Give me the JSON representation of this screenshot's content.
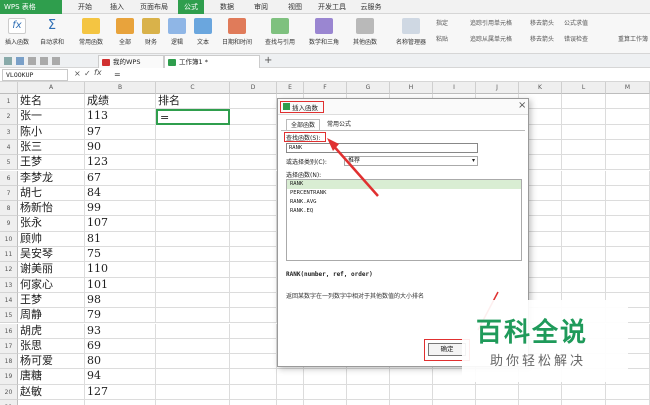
{
  "menu": {
    "app_label": "WPS 表格",
    "tabs": [
      "开始",
      "插入",
      "页面布局",
      "公式",
      "数据",
      "审阅",
      "视图",
      "开发工具",
      "云服务"
    ],
    "active_tab": "公式"
  },
  "ribbon": {
    "buttons": [
      "插入函数",
      "自动求和",
      "常用函数",
      "全部",
      "财务",
      "逻辑",
      "文本",
      "日期和时间",
      "查找与引用",
      "数学和三角",
      "其他函数",
      "名称管理器",
      "粘贴"
    ],
    "small_items": [
      "指定",
      "追踪引用单元格",
      "移去箭头",
      "追踪从属单元格",
      "移去箭头",
      "公式求值",
      "错误检查",
      "重算工作簿"
    ]
  },
  "doc_tabs": [
    "我的WPS",
    "工作簿1 *"
  ],
  "formula_bar": {
    "name_box": "VLOOKUP",
    "fx": "fx",
    "value": "="
  },
  "columns": [
    "A",
    "B",
    "C",
    "D",
    "E",
    "F",
    "G",
    "H",
    "I",
    "J",
    "K",
    "L",
    "M"
  ],
  "rows": [
    "1",
    "2",
    "3",
    "4",
    "5",
    "6",
    "7",
    "8",
    "9",
    "10",
    "11",
    "12",
    "13",
    "14",
    "15",
    "16",
    "17",
    "18",
    "19",
    "20",
    "21"
  ],
  "table": [
    [
      "姓名",
      "成绩",
      "排名"
    ],
    [
      "张一",
      "113",
      "="
    ],
    [
      "陈小",
      "97",
      ""
    ],
    [
      "张三",
      "90",
      ""
    ],
    [
      "王梦",
      "123",
      ""
    ],
    [
      "李梦龙",
      "67",
      ""
    ],
    [
      "胡七",
      "84",
      ""
    ],
    [
      "杨新怡",
      "99",
      ""
    ],
    [
      "张永",
      "107",
      ""
    ],
    [
      "顾帅",
      "81",
      ""
    ],
    [
      "吴安琴",
      "75",
      ""
    ],
    [
      "谢美丽",
      "110",
      ""
    ],
    [
      "何家心",
      "101",
      ""
    ],
    [
      "王梦",
      "98",
      ""
    ],
    [
      "周静",
      "79",
      ""
    ],
    [
      "胡虎",
      "93",
      ""
    ],
    [
      "张思",
      "69",
      ""
    ],
    [
      "杨可爱",
      "80",
      ""
    ],
    [
      "唐糖",
      "94",
      ""
    ],
    [
      "赵敏",
      "127",
      ""
    ]
  ],
  "dialog": {
    "title": "插入函数",
    "tab_all": "全部函数",
    "tab_common": "常用公式",
    "search_label": "查找函数(S):",
    "search_value": "RANK",
    "category_label": "或选择类别(C):",
    "category_value": "推荐",
    "select_label": "选择函数(N):",
    "functions": [
      "RANK",
      "PERCENTRANK",
      "RANK.AVG",
      "RANK.EQ"
    ],
    "signature": "RANK(number, ref, order)",
    "description": "返回某数字在一列数字中相对于其他数值的大小排名",
    "ok": "确定",
    "close": "×"
  },
  "watermark": {
    "main": "百科全说",
    "sub": "助你轻松解决"
  }
}
